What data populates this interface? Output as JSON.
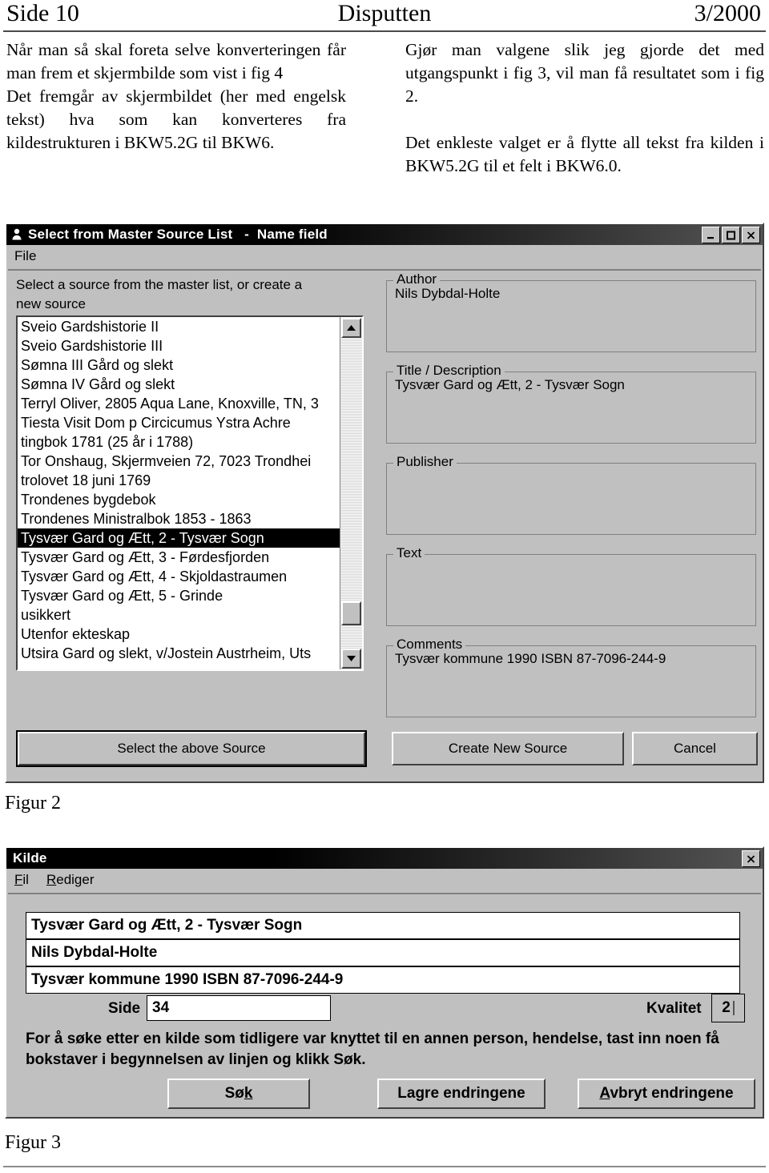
{
  "running_head": {
    "left": "Side 10",
    "center": "Disputten",
    "right": "3/2000"
  },
  "body_text": {
    "left_column": [
      "Når man så skal foreta selve konverteringen får man frem et skjermbilde som vist i fig 4",
      "Det fremgår av skjermbildet (her med engelsk tekst) hva som kan konverteres fra kildestrukturen i BKW5.2G til BKW6."
    ],
    "right_column": [
      "Gjør man valgene slik jeg gjorde det med utgangspunkt i fig 3, vil man få resultatet som i fig 2.",
      "Det enkleste valget er å flytte all tekst fra kilden i BKW5.2G til et felt i BKW6.0."
    ]
  },
  "figure2": {
    "caption": "Figur 2",
    "window": {
      "title": "Select from Master Source List   -  Name field",
      "icon": "person-bust-icon",
      "menu": [
        "File"
      ],
      "titlebar_buttons": [
        {
          "name": "minimize-button",
          "glyph": "_"
        },
        {
          "name": "maximize-button",
          "glyph": "□"
        },
        {
          "name": "close-button",
          "glyph": "×"
        }
      ],
      "instruction": "Select a source from the master list, or create a\nnew source",
      "list_items": [
        {
          "label": "Sveio Gardshistorie II",
          "selected": false
        },
        {
          "label": "Sveio Gardshistorie III",
          "selected": false
        },
        {
          "label": "Sømna III Gård og slekt",
          "selected": false
        },
        {
          "label": "Sømna IV Gård og slekt",
          "selected": false
        },
        {
          "label": "Terryl Oliver, 2805 Aqua Lane, Knoxville, TN, 3",
          "selected": false
        },
        {
          "label": "Tiesta Visit Dom p Circicumus Ystra Achre",
          "selected": false
        },
        {
          "label": "tingbok 1781 (25 år i 1788)",
          "selected": false
        },
        {
          "label": "Tor Onshaug, Skjermveien 72, 7023 Trondhei",
          "selected": false
        },
        {
          "label": "trolovet 18 juni 1769",
          "selected": false
        },
        {
          "label": "Trondenes bygdebok",
          "selected": false
        },
        {
          "label": "Trondenes Ministralbok 1853 - 1863",
          "selected": false
        },
        {
          "label": "Tysvær Gard og Ætt, 2 - Tysvær Sogn",
          "selected": true
        },
        {
          "label": "Tysvær Gard og Ætt, 3 - Førdesfjorden",
          "selected": false
        },
        {
          "label": "Tysvær Gard og Ætt, 4 - Skjoldastraumen",
          "selected": false
        },
        {
          "label": "Tysvær Gard og Ætt, 5 - Grinde",
          "selected": false
        },
        {
          "label": "usikkert",
          "selected": false
        },
        {
          "label": "Utenfor ekteskap",
          "selected": false
        },
        {
          "label": "Utsira Gard og slekt, v/Jostein Austrheim, Uts",
          "selected": false
        }
      ],
      "fields": [
        {
          "label": "Author",
          "value": "Nils Dybdal-Holte"
        },
        {
          "label": "Title / Description",
          "value": "Tysvær Gard og Ætt, 2 - Tysvær Sogn"
        },
        {
          "label": "Publisher",
          "value": ""
        },
        {
          "label": "Text",
          "value": ""
        },
        {
          "label": "Comments",
          "value": "Tysvær kommune 1990 ISBN 87-7096-244-9"
        }
      ],
      "buttons": [
        {
          "name": "select-above-source-button",
          "label": "Select the above Source",
          "default": true
        },
        {
          "name": "create-new-source-button",
          "label": "Create New Source",
          "default": false
        },
        {
          "name": "cancel-button",
          "label": "Cancel",
          "default": false
        }
      ]
    }
  },
  "figure3": {
    "caption": "Figur 3",
    "window": {
      "title": "Kilde",
      "menu": [
        {
          "label": "Fil",
          "accel": "F"
        },
        {
          "label": "Rediger",
          "accel": "R"
        }
      ],
      "titlebar_buttons": [
        {
          "name": "close-button",
          "glyph": "×"
        }
      ],
      "fields": [
        {
          "name": "title-field",
          "value": "Tysvær Gard og Ætt, 2 - Tysvær Sogn"
        },
        {
          "name": "author-field",
          "value": "Nils Dybdal-Holte"
        },
        {
          "name": "publisher-field",
          "value": "Tysvær kommune 1990 ISBN 87-7096-244-9"
        }
      ],
      "page_label": "Side",
      "page_value": "34",
      "quality_label": "Kvalitet",
      "quality_value": "2",
      "help_text": "For å søke etter en kilde som tidligere var knyttet til en annen person, hendelse, tast inn noen få bokstaver i begynnelsen av linjen og klikk Søk.",
      "buttons": [
        {
          "name": "search-button",
          "label": "Søk",
          "accel": "k"
        },
        {
          "name": "save-changes-button",
          "label": "Lagre endringene",
          "accel": ""
        },
        {
          "name": "cancel-changes-button",
          "label": "Avbryt endringene",
          "accel": "A"
        }
      ]
    }
  }
}
